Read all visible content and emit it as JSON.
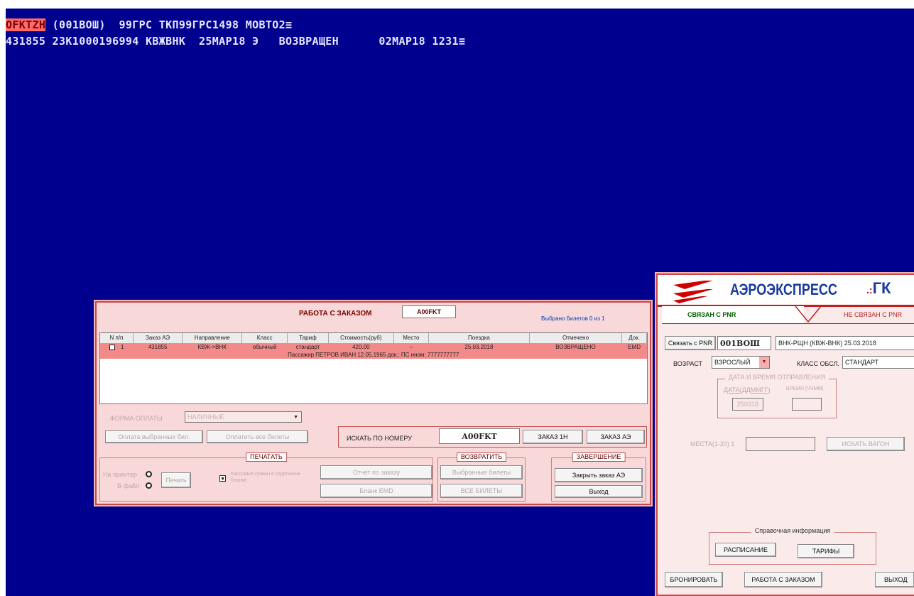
{
  "terminal": {
    "line1_highlight": "OFKTZH",
    "line1_rest": " (001BOШ)  99ГРС ТКП99ГРС1498 MOBTO2≡",
    "line2": "431855 23K1000196994 KBЖBHK  25MAP18 Э   BO3BPAЩEH      02MAP18 1231≡"
  },
  "order_panel": {
    "title": "РАБОТА С ЗАКАЗОМ",
    "order_code": "A00FKT",
    "selected_info": "Выбрано билетов 0 из 1",
    "columns": [
      "N п/п",
      "Заказ АЭ",
      "Направление",
      "Класс",
      "Тариф",
      "Стоимость(руб)",
      "Место",
      "Поездка",
      "Отмечено",
      "Док."
    ],
    "rows": [
      {
        "n": "1",
        "order": "431855",
        "direction": "КВЖ->ВНК",
        "class": "обычный",
        "tariff": "стандарт",
        "price": "420.00",
        "seat": "--",
        "trip": "25.03.2018",
        "status": "ВОЗВРАЩЕНО",
        "doc": "EMD"
      }
    ],
    "passenger_line": "Пассажир ПЕТРОВ ИВАН 12.05.1965 док.: ПС нном: 7777777777",
    "payment_label": "ФОРМА ОПЛАТЫ",
    "payment_value": "НАЛИЧНЫЕ",
    "btn_reserve_sel": "Оплата выбранных бил.",
    "btn_reserve_all": "Оплатить все билеты",
    "search_label": "ИСКАТЬ ПО НОМЕРУ",
    "search_value": "A00FKT",
    "btn_order_1h": "ЗАКАЗ 1Н",
    "btn_order_ae": "ЗАКАЗ АЭ",
    "print_group": "ПЕЧАТАТЬ",
    "print_printer": "На принтер",
    "print_file": "В файл",
    "print_btn": "Печать",
    "print_check": "Кассовые суммы в отдельном бланке",
    "print_order": "Отчет по заказу",
    "print_emd": "Бланк EMD",
    "return_group": "ВОЗВРАТИТЬ",
    "return_selected": "Выбранные билеты",
    "return_all": "ВСЕ БИЛЕТЫ",
    "finish_group": "ЗАВЕРШЕНИЕ",
    "finish_close": "Закрыть заказ АЭ",
    "finish_exit": "Выход"
  },
  "aero_panel": {
    "brand": "АЭРОЭКСПРЕСС",
    "brand2": "ГК",
    "tab_linked": "СВЯЗАН С PNR",
    "tab_unlinked": "НЕ СВЯЗАН С PNR",
    "btn_link": "Связать с PNR",
    "pnr_value": "001BOШ",
    "route_value": "ВНК-РЩН (КВЖ-ВНК) 25.03.2018",
    "age_label": "ВОЗРАСТ",
    "age_value": "ВЗРОСЛЫЙ",
    "class_label": "КЛАСС ОБСЛ.",
    "class_value": "СТАНДАРТ",
    "date_group": "ДАТА И ВРЕМЯ ОТПРАВЛЕНИЯ",
    "date_sub": "ДАТА(ДДММГГ)",
    "time_sub": "ВРЕМЯ (ЧЧММ)",
    "date_value": "250318",
    "seats_label": "МЕСТА(1-20) 1",
    "btn_find": "ИСКАТЬ ВАГОН",
    "ref_group": "Справочная информация",
    "btn_schedule": "РАСПИСАНИЕ",
    "btn_tariffs": "ТАРИФЫ",
    "btn_book": "БРОНИРОВАТЬ",
    "btn_work": "РАБОТА С ЗАКАЗОМ",
    "btn_exit": "ВЫХОД"
  },
  "colors": {
    "terminal_bg": "#00008e",
    "panel_bg": "#f8d8d8",
    "accent": "#c00000",
    "row_highlight": "#f28a8a"
  }
}
